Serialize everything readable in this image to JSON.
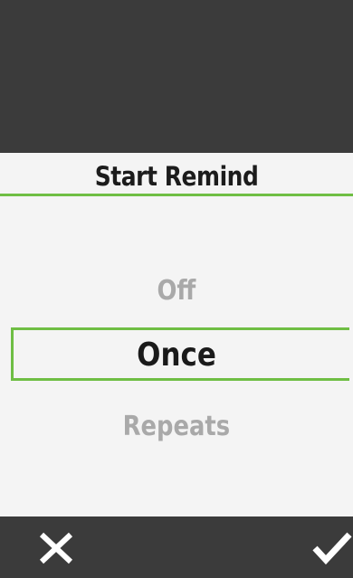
{
  "header": {
    "title": "Start Remind"
  },
  "picker": {
    "options": [
      "Off",
      "Once",
      "Repeats"
    ],
    "selected": "Once"
  },
  "footer": {
    "cancel_icon": "close-icon",
    "confirm_icon": "check-icon"
  },
  "colors": {
    "accent": "#6fbe44",
    "bar": "#3b3b3b",
    "background": "#f4f4f4"
  }
}
